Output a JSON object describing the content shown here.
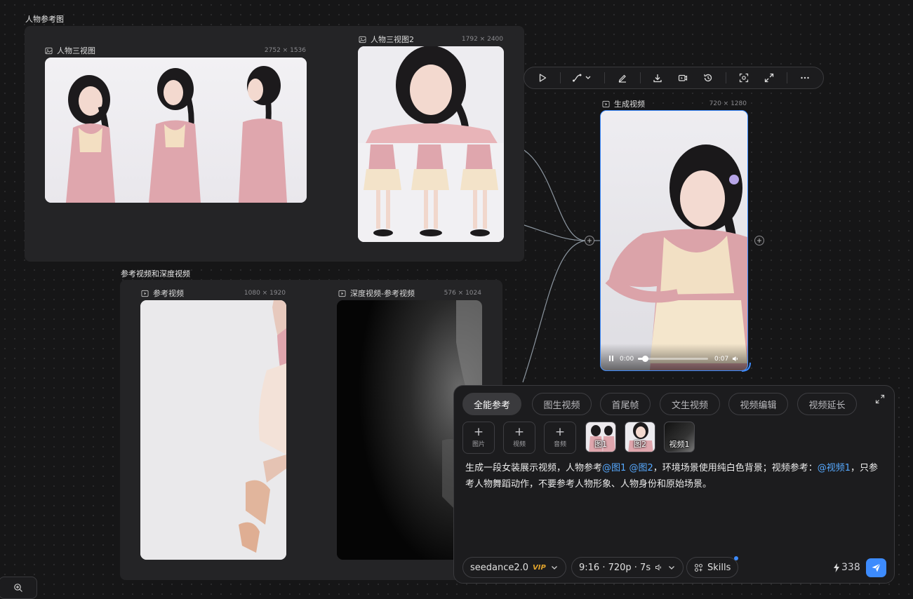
{
  "groups": {
    "character_ref": {
      "title": "人物参考图"
    },
    "ref_video": {
      "title": "参考视频和深度视频"
    }
  },
  "nodes": {
    "three_view": {
      "title": "人物三视图",
      "dims": "2752 × 1536"
    },
    "three_view2": {
      "title": "人物三视图2",
      "dims": "1792 × 2400"
    },
    "gen_video": {
      "title": "生成视频",
      "dims": "720 × 1280",
      "time_current": "0:00",
      "time_total": "0:07",
      "progress": 0.1
    },
    "ref_video": {
      "title": "参考视频",
      "dims": "1080 × 1920"
    },
    "depth_video": {
      "title": "深度视频-参考视频",
      "dims": "576 × 1024"
    }
  },
  "toolbar": {
    "icons": [
      "play-icon",
      "connect-icon",
      "chevron-down-icon",
      "edit-icon",
      "download-icon",
      "video-frame-icon",
      "history-icon",
      "capture-icon",
      "expand-icon",
      "more-icon"
    ]
  },
  "panel": {
    "tabs": [
      "全能参考",
      "图生视频",
      "首尾帧",
      "文生视频",
      "视频编辑",
      "视频延长"
    ],
    "active_tab": "全能参考",
    "add_buttons": [
      "图片",
      "视频",
      "音频"
    ],
    "refs": [
      "图1",
      "图2",
      "视频1"
    ],
    "prompt": {
      "t1": "生成一段女装展示视频，人物参考",
      "m1": "@图1",
      "m2": "@图2",
      "t2": "，环境场景使用纯白色背景；视频参考：",
      "m3": "@视频1",
      "t3": "，只参考人物舞蹈动作，不要参考人物形象、人物身份和原始场景。"
    },
    "model": "seedance2.0",
    "vip": "VIP",
    "params": "9:16 · 720p · 7s",
    "skills": "Skills",
    "credits": "338"
  },
  "colors": {
    "accent": "#3d8bfd",
    "mention": "#56a9ff",
    "vip": "#e0a32c"
  }
}
